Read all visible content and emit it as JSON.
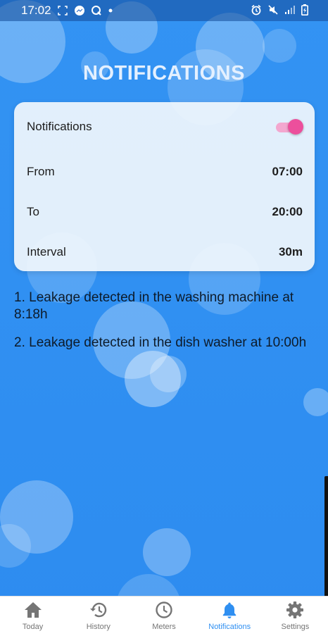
{
  "status_bar": {
    "time": "17:02",
    "left_icons": [
      "screenshot-icon",
      "messenger-icon",
      "q-app-icon",
      "dot-icon"
    ],
    "right_icons": [
      "alarm-icon",
      "mute-icon",
      "signal-icon",
      "battery-charging-icon"
    ]
  },
  "page": {
    "title": "NOTIFICATIONS"
  },
  "settings_card": {
    "notifications_label": "Notifications",
    "notifications_enabled": true,
    "from_label": "From",
    "from_value": "07:00",
    "to_label": "To",
    "to_value": "20:00",
    "interval_label": "Interval",
    "interval_value": "30m"
  },
  "alerts": [
    "1. Leakage detected in the washing machine at 8:18h",
    "2. Leakage detected in the dish washer at 10:00h"
  ],
  "bottom_nav": {
    "items": [
      {
        "label": "Today",
        "icon": "home-icon"
      },
      {
        "label": "History",
        "icon": "history-icon"
      },
      {
        "label": "Meters",
        "icon": "clock-icon"
      },
      {
        "label": "Notifications",
        "icon": "bell-icon"
      },
      {
        "label": "Settings",
        "icon": "gear-icon"
      }
    ],
    "active": "Notifications"
  },
  "colors": {
    "background": "#2f8ff1",
    "accent": "#2f8ff1",
    "toggle_thumb": "#ec4f9c",
    "toggle_track": "#f3a7cf",
    "inactive_nav": "#757575"
  }
}
